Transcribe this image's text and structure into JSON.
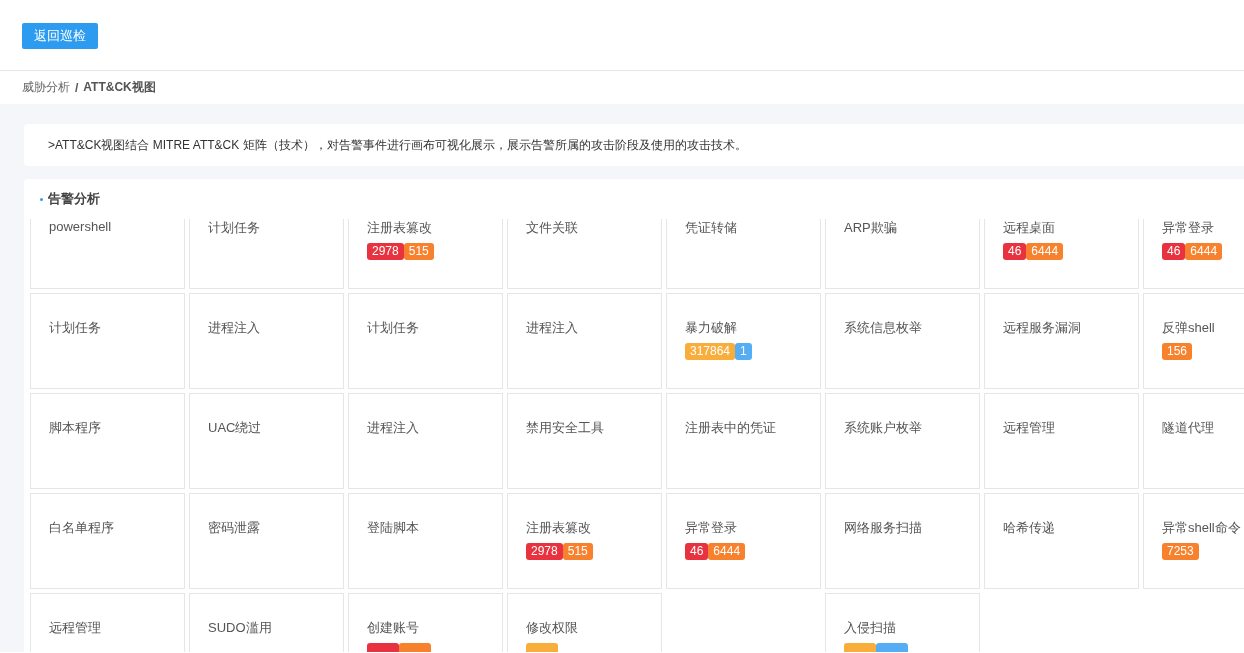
{
  "back_button": "返回巡检",
  "breadcrumb_separator": "/",
  "breadcrumb": [
    {
      "label": "威胁分析",
      "current": false
    },
    {
      "label": "ATT&CK视图",
      "current": true
    }
  ],
  "description": ">ATT&CK视图结合 MITRE ATT&CK 矩阵（技术），对告警事件进行画布可视化展示，展示告警所属的攻击阶段及使用的攻击技术。",
  "panel": {
    "title": "告警分析",
    "cards": [
      {
        "kind": "technique",
        "label": "powershell"
      },
      {
        "kind": "technique",
        "label": "计划任务"
      },
      {
        "kind": "technique",
        "label": "注册表篡改",
        "badges": [
          {
            "text": "2978",
            "color": "#e8323f"
          },
          {
            "text": "515",
            "color": "#f7812d"
          }
        ]
      },
      {
        "kind": "technique",
        "label": "文件关联"
      },
      {
        "kind": "technique",
        "label": "凭证转储"
      },
      {
        "kind": "technique",
        "label": "ARP欺骗"
      },
      {
        "kind": "technique",
        "label": "远程桌面",
        "badges": [
          {
            "text": "46",
            "color": "#e8323f"
          },
          {
            "text": "6444",
            "color": "#f7812d"
          }
        ]
      },
      {
        "kind": "technique",
        "label": "异常登录",
        "badges": [
          {
            "text": "46",
            "color": "#e8323f"
          },
          {
            "text": "6444",
            "color": "#f7812d"
          }
        ]
      },
      {
        "kind": "technique",
        "label": "计划任务"
      },
      {
        "kind": "technique",
        "label": "进程注入"
      },
      {
        "kind": "technique",
        "label": "计划任务"
      },
      {
        "kind": "technique",
        "label": "进程注入"
      },
      {
        "kind": "technique",
        "label": "暴力破解",
        "badges": [
          {
            "text": "317864",
            "color": "#f9ad3a"
          },
          {
            "text": "1",
            "color": "#55aef5"
          }
        ]
      },
      {
        "kind": "technique",
        "label": "系统信息枚举"
      },
      {
        "kind": "technique",
        "label": "远程服务漏洞"
      },
      {
        "kind": "technique",
        "label": "反弹shell",
        "badges": [
          {
            "text": "156",
            "color": "#f7812d"
          }
        ]
      },
      {
        "kind": "technique",
        "label": "脚本程序"
      },
      {
        "kind": "technique",
        "label": "UAC绕过"
      },
      {
        "kind": "technique",
        "label": "进程注入"
      },
      {
        "kind": "technique",
        "label": "禁用安全工具"
      },
      {
        "kind": "technique",
        "label": "注册表中的凭证"
      },
      {
        "kind": "technique",
        "label": "系统账户枚举"
      },
      {
        "kind": "technique",
        "label": "远程管理"
      },
      {
        "kind": "technique",
        "label": "隧道代理"
      },
      {
        "kind": "technique",
        "label": "白名单程序"
      },
      {
        "kind": "technique",
        "label": "密码泄露"
      },
      {
        "kind": "technique",
        "label": "登陆脚本"
      },
      {
        "kind": "technique",
        "label": "注册表篡改",
        "badges": [
          {
            "text": "2978",
            "color": "#e8323f"
          },
          {
            "text": "515",
            "color": "#f7812d"
          }
        ]
      },
      {
        "kind": "technique",
        "label": "异常登录",
        "badges": [
          {
            "text": "46",
            "color": "#e8323f"
          },
          {
            "text": "6444",
            "color": "#f7812d"
          }
        ]
      },
      {
        "kind": "technique",
        "label": "网络服务扫描"
      },
      {
        "kind": "technique",
        "label": "哈希传递"
      },
      {
        "kind": "technique",
        "label": "异常shell命令",
        "badges": [
          {
            "text": "7253",
            "color": "#f7812d"
          }
        ]
      },
      {
        "kind": "technique",
        "label": "远程管理"
      },
      {
        "kind": "technique",
        "label": "SUDO滥用"
      },
      {
        "kind": "technique",
        "label": "创建账号",
        "badges": [
          {
            "color": "#e8323f"
          },
          {
            "color": "#f7812d"
          }
        ]
      },
      {
        "kind": "technique",
        "label": "修改权限",
        "badges": [
          {
            "color": "#f9ad3a"
          }
        ]
      },
      {
        "kind": "blank"
      },
      {
        "kind": "technique",
        "label": "入侵扫描",
        "badges": [
          {
            "color": "#f9ad3a"
          },
          {
            "color": "#55aef5"
          }
        ]
      }
    ]
  }
}
